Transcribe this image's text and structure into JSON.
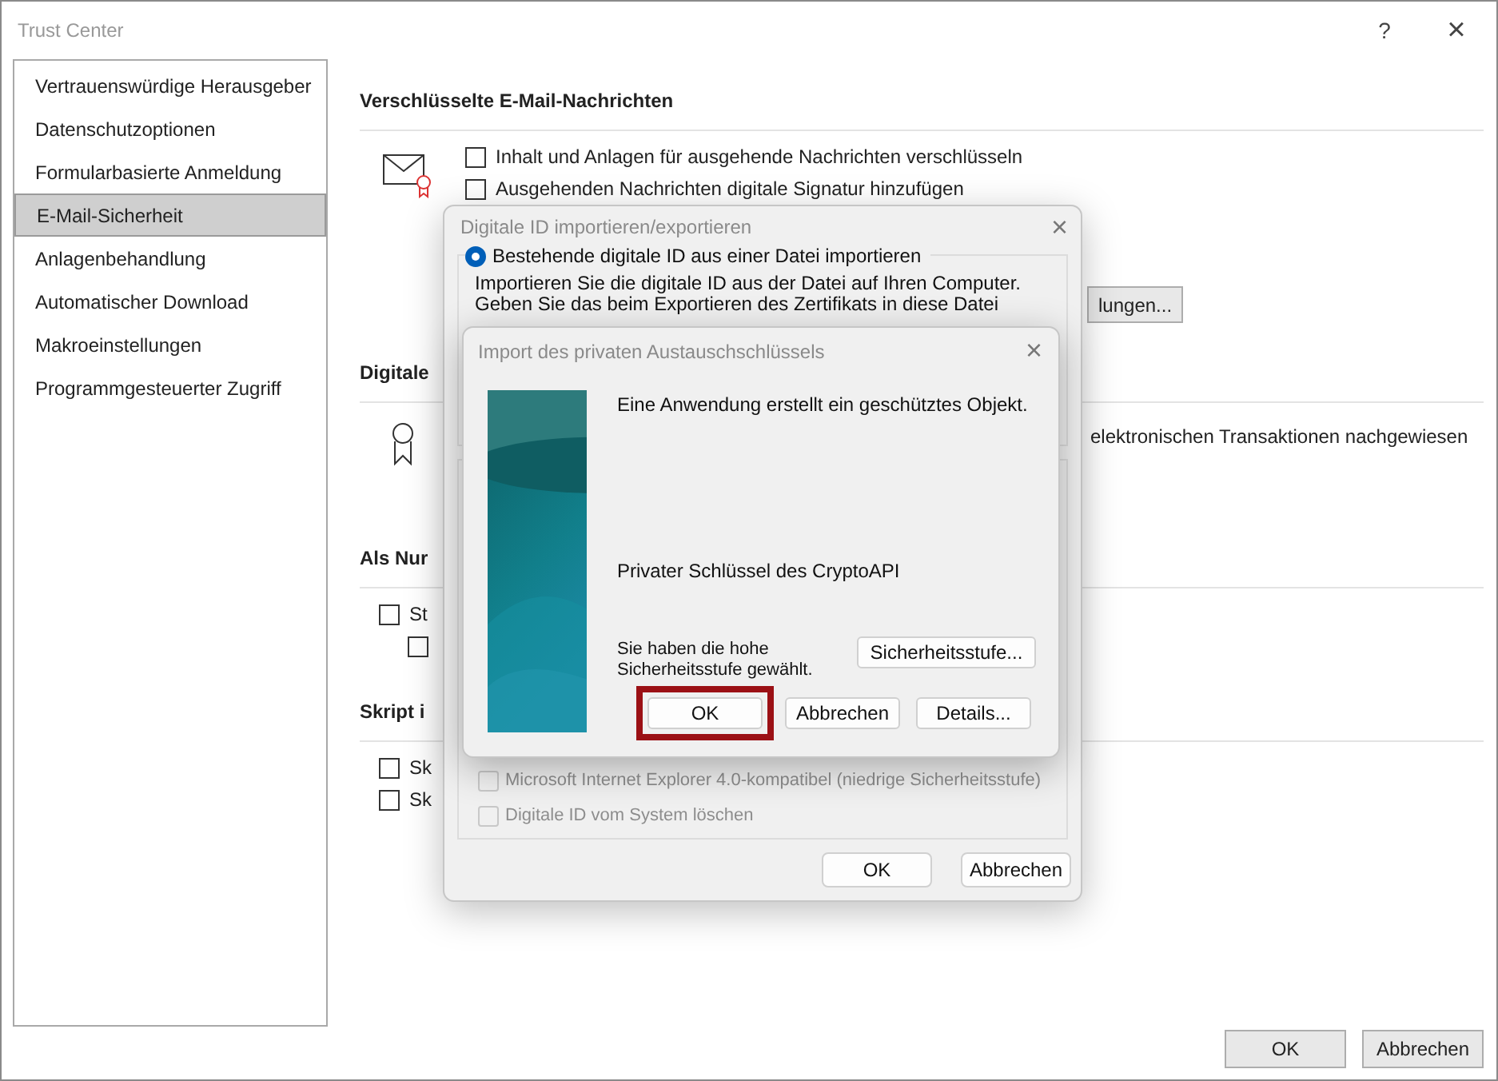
{
  "window": {
    "title": "Trust Center",
    "help": "?",
    "close": "×"
  },
  "sidebar": {
    "items": [
      {
        "label": "Vertrauenswürdige Herausgeber",
        "selected": false
      },
      {
        "label": "Datenschutzoptionen",
        "selected": false
      },
      {
        "label": "Formularbasierte Anmeldung",
        "selected": false
      },
      {
        "label": "E-Mail-Sicherheit",
        "selected": true
      },
      {
        "label": "Anlagenbehandlung",
        "selected": false
      },
      {
        "label": "Automatischer Download",
        "selected": false
      },
      {
        "label": "Makroeinstellungen",
        "selected": false
      },
      {
        "label": "Programmgesteuerter Zugriff",
        "selected": false
      }
    ]
  },
  "encrypted_email": {
    "heading": "Verschlüsselte E-Mail-Nachrichten",
    "options": [
      {
        "label": "Inhalt und Anlagen für ausgehende Nachrichten verschlüsseln",
        "checked": false
      },
      {
        "label": "Ausgehenden Nachrichten digitale Signatur hinzufügen",
        "checked": false
      }
    ],
    "button": "lungen..."
  },
  "digital_ids": {
    "heading": "Digitale",
    "text": "elektronischen Transaktionen nachgewiesen"
  },
  "read_as_plain": {
    "heading": "Als Nur",
    "options": [
      {
        "label": "St",
        "checked": false
      },
      {
        "checked": false
      }
    ]
  },
  "script": {
    "heading": "Skript i",
    "options": [
      {
        "label": "Sk",
        "checked": false
      },
      {
        "label": "Sk",
        "checked": false
      }
    ]
  },
  "footer_buttons": [
    "OK",
    "Abbrechen"
  ],
  "export_dialog": {
    "title": "Digitale ID importieren/exportieren",
    "close": "×",
    "options": [
      {
        "label": "Bestehende digitale ID aus einer Datei importieren",
        "selected": true
      }
    ],
    "description": [
      "Importieren Sie die digitale ID aus der Datei auf Ihren Computer.",
      "Geben Sie das beim Exportieren des Zertifikats in diese Datei"
    ],
    "checkboxes": [
      {
        "label": "Microsoft Internet Explorer 4.0-kompatibel (niedrige Sicherheitsstufe)",
        "checked": false,
        "disabled": true
      },
      {
        "label": "Digitale ID vom System löschen",
        "checked": false,
        "disabled": true
      }
    ],
    "buttons": [
      "OK",
      "Abbrechen"
    ]
  },
  "key_dialog": {
    "title": "Import des privaten Austauschschlüssels",
    "close": "×",
    "message": "Eine Anwendung erstellt ein geschütztes Objekt.",
    "key_name": "Privater Schlüssel des CryptoAPI",
    "security_text": "Sie haben die hohe Sicherheitsstufe gewählt.",
    "security_button": "Sicherheitsstufe...",
    "buttons": [
      {
        "label": "OK",
        "highlighted": true
      },
      {
        "label": "Abbrechen",
        "highlighted": false
      },
      {
        "label": "Details...",
        "highlighted": false
      }
    ]
  }
}
